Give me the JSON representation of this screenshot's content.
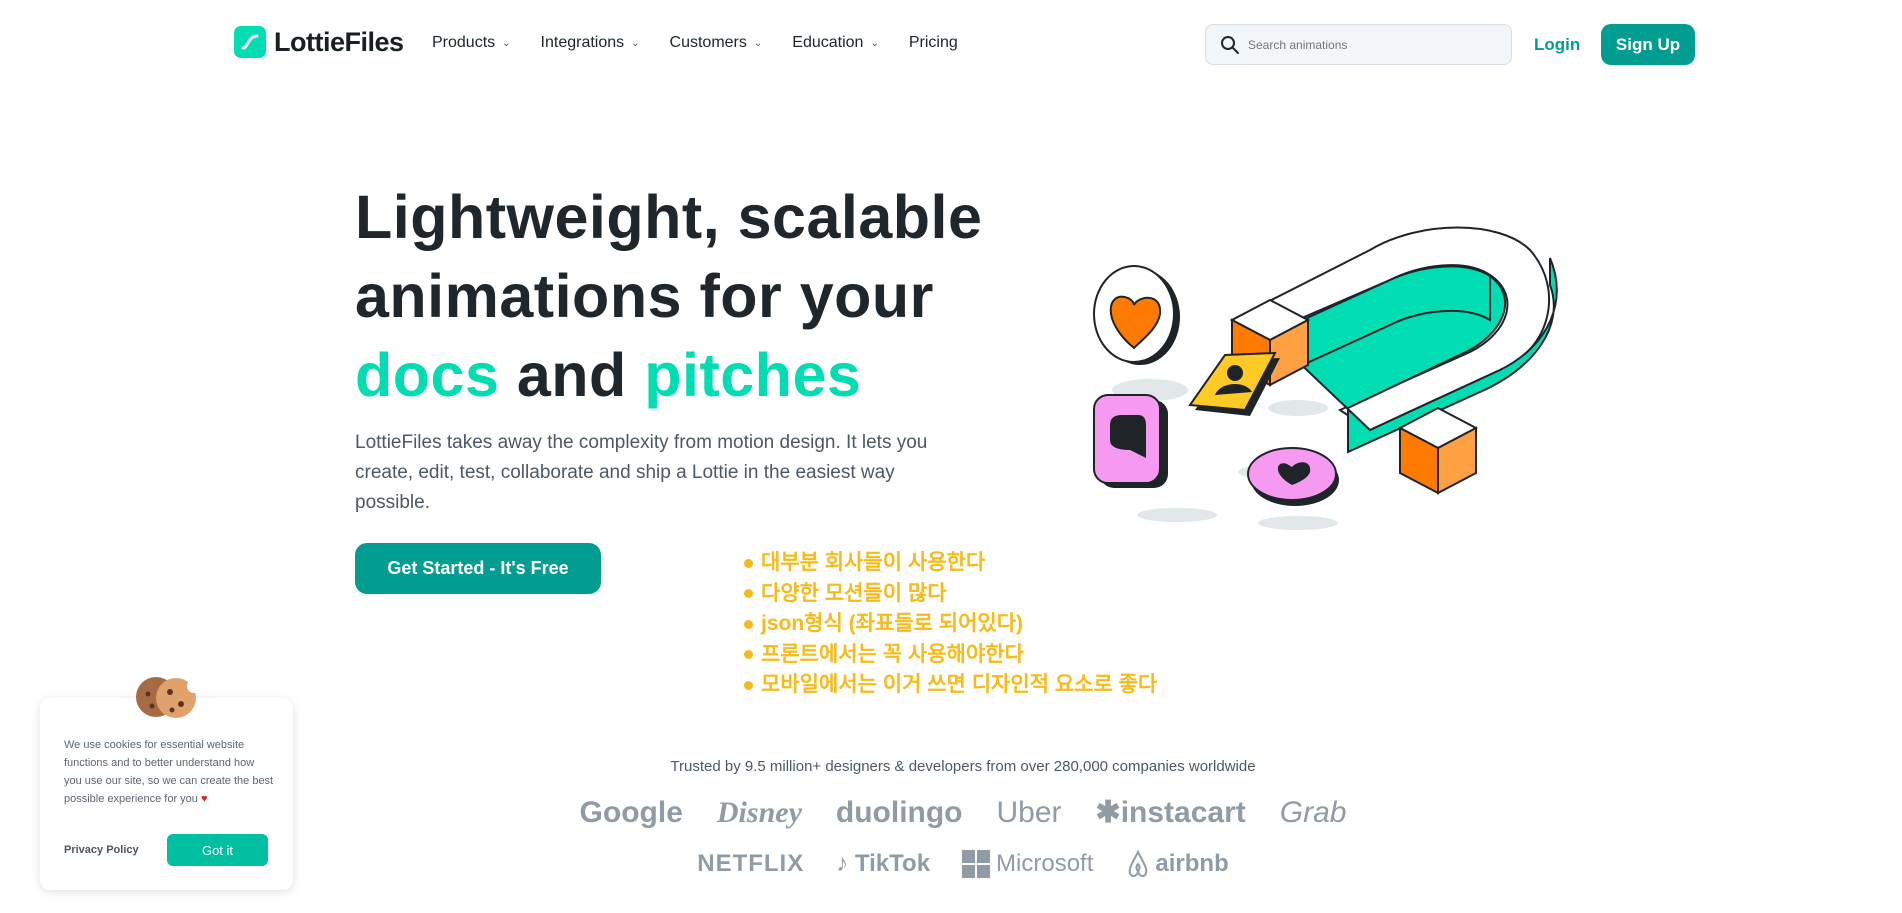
{
  "header": {
    "logo_text": "LottieFiles",
    "menu": [
      {
        "label": "Products",
        "has_dropdown": true
      },
      {
        "label": "Integrations",
        "has_dropdown": true
      },
      {
        "label": "Customers",
        "has_dropdown": true
      },
      {
        "label": "Education",
        "has_dropdown": true
      },
      {
        "label": "Pricing",
        "has_dropdown": false
      }
    ],
    "search_placeholder": "Search animations",
    "login_label": "Login",
    "signup_label": "Sign Up"
  },
  "hero": {
    "headline_line1": "Lightweight, scalable",
    "headline_line2": "animations for your",
    "headline_accent1": "docs",
    "headline_and": "and",
    "headline_accent2": "pitches",
    "subtext": "LottieFiles takes away the complexity from motion design. It lets you create, edit, test, collaborate and ship a Lottie in the easiest way possible.",
    "cta_label": "Get Started - It's Free"
  },
  "notes": [
    "대부분 회사들이 사용한다",
    "다양한 모션들이 많다",
    "json형식 (좌표들로 되어있다)",
    "프론트에서는 꼭 사용해야한다",
    "모바일에서는 이거 쓰면 디자인적 요소로 좋다"
  ],
  "trust": {
    "text": "Trusted by 9.5 million+ designers & developers from over 280,000 companies worldwide",
    "row1": [
      "Google",
      "Disney",
      "duolingo",
      "Uber",
      "instacart",
      "Grab"
    ],
    "row2": [
      "NETFLIX",
      "TikTok",
      "Microsoft",
      "airbnb"
    ]
  },
  "cookie": {
    "text": "We use cookies for essential website functions and to better understand how you use our site, so we can create the best possible experience for you",
    "privacy_label": "Privacy Policy",
    "gotit_label": "Got it"
  },
  "colors": {
    "brand_teal": "#019d91",
    "accent_mint": "#00ddb3",
    "note_yellow": "#f7ba18",
    "orange": "#ff7a00",
    "pink": "#f59af0"
  }
}
